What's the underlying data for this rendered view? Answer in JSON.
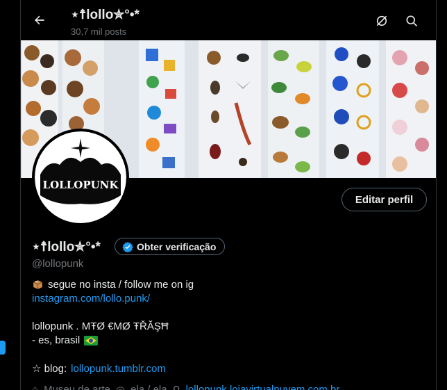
{
  "header": {
    "title": "⋆☨lollo✮°•*",
    "posts_count": "30,7 mil posts"
  },
  "profile": {
    "display_name": "⋆☨lollo✮°•*",
    "handle": "@lollopunk",
    "edit_button": "Editar perfil",
    "verify_button": "Obter verificação",
    "avatar_text": "LOLLOPUNK"
  },
  "bio": {
    "line1_text": "segue no insta / follow me on ig",
    "line1_link": "instagram.com/lollo.punk/",
    "line2": "lollopunk . MŦØ €MØ ŦŘĂŞĦ",
    "line3": "- es, brasil",
    "line4_prefix": "☆ blog:",
    "line4_link": "lollopunk.tumblr.com"
  },
  "meta": {
    "category": "Museu de arte",
    "location": "ela / ela",
    "website": "lollopunk.lojavirtualnuvem.com.br"
  },
  "colors": {
    "accent": "#1d9bf0",
    "muted": "#71767b",
    "text": "#e7e9ea",
    "border": "#536471",
    "background": "#000000"
  },
  "icons": {
    "back": "back-arrow-icon",
    "refresh": "no-refresh-icon",
    "search": "search-icon",
    "verified": "verified-badge-icon",
    "box": "package-icon",
    "flag": "brazil-flag-icon",
    "category": "briefcase-icon",
    "location": "location-pin-icon",
    "website": "link-icon"
  }
}
